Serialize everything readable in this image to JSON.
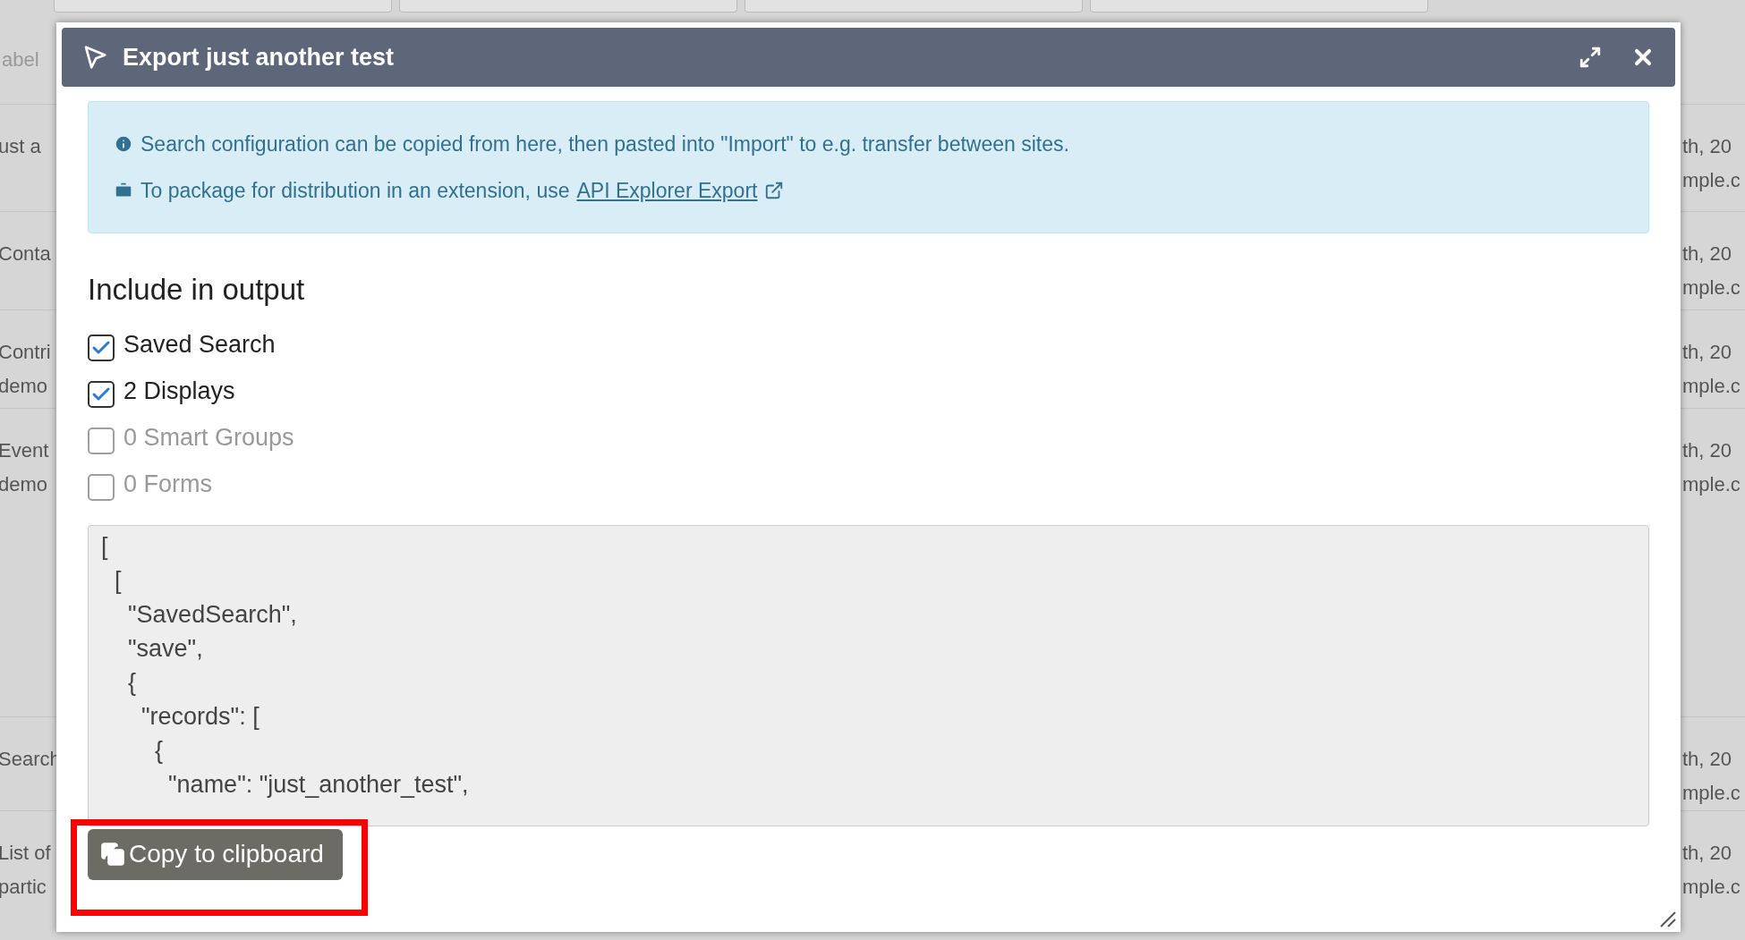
{
  "background_table": {
    "header_label": "abel",
    "rows": [
      {
        "left": [
          "ust a"
        ],
        "right": [
          "th, 20",
          "mple.c"
        ]
      },
      {
        "left": [
          "Conta"
        ],
        "right": [
          "th, 20",
          "mple.c"
        ]
      },
      {
        "left": [
          "Contri",
          "demo"
        ],
        "right": [
          "th, 20",
          "mple.c"
        ]
      },
      {
        "left": [
          "Event",
          "demo"
        ],
        "right": [
          "th, 20",
          "mple.c"
        ]
      },
      {
        "left": [
          "Search"
        ],
        "right": [
          "th, 20",
          "mple.c"
        ]
      },
      {
        "left": [
          "List of",
          "partic"
        ],
        "right": [
          "th, 20",
          "mple.c"
        ]
      }
    ]
  },
  "dialog": {
    "title": "Export just another test",
    "info": {
      "line_1": "Search configuration can be copied from here, then pasted into \"Import\" to e.g. transfer between sites.",
      "line_2": "To package for distribution in an extension, use",
      "link": "API Explorer Export"
    },
    "section_heading": "Include in output",
    "options": [
      {
        "label": "Saved Search",
        "checked": true,
        "disabled": false
      },
      {
        "label": "2 Displays",
        "checked": true,
        "disabled": false
      },
      {
        "label": "0 Smart Groups",
        "checked": false,
        "disabled": true
      },
      {
        "label": "0 Forms",
        "checked": false,
        "disabled": true
      }
    ],
    "output_lines": [
      "[",
      "  [",
      "    \"SavedSearch\",",
      "    \"save\",",
      "    {",
      "      \"records\": [",
      "        {",
      "          \"name\": \"just_another_test\","
    ],
    "copy_button": "Copy to clipboard",
    "highlight": true
  }
}
